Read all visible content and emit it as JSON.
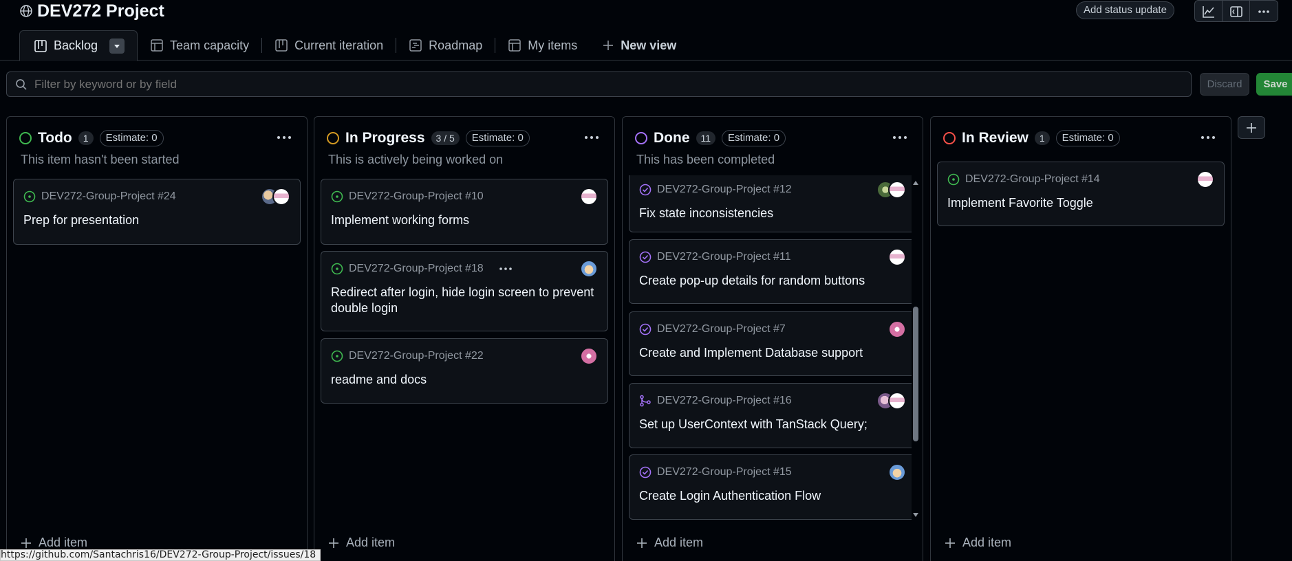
{
  "project": {
    "title": "DEV272 Project",
    "status_update": "Add status update"
  },
  "tabs": [
    {
      "label": "Backlog",
      "icon": "board-icon"
    },
    {
      "label": "Team capacity",
      "icon": "table-icon"
    },
    {
      "label": "Current iteration",
      "icon": "board-icon"
    },
    {
      "label": "Roadmap",
      "icon": "roadmap-icon"
    },
    {
      "label": "My items",
      "icon": "table-icon"
    },
    {
      "label": "New view",
      "icon": "plus-icon"
    }
  ],
  "filter": {
    "placeholder": "Filter by keyword or by field",
    "discard": "Discard",
    "save": "Save"
  },
  "colors": {
    "todo": "#3fb950",
    "in_progress": "#d29922",
    "done": "#a371f7",
    "in_review": "#f85149",
    "accent_save": "#238636"
  },
  "columns": [
    {
      "name": "Todo",
      "count": "1",
      "estimate": "Estimate: 0",
      "description": "This item hasn't been started",
      "add_item": "Add item",
      "cards": [
        {
          "ref": "DEV272-Group-Project #24",
          "title": "Prep for presentation"
        }
      ]
    },
    {
      "name": "In Progress",
      "count": "3 / 5",
      "estimate": "Estimate: 0",
      "description": "This is actively being worked on",
      "add_item": "Add item",
      "cards": [
        {
          "ref": "DEV272-Group-Project #10",
          "title": "Implement working forms"
        },
        {
          "ref": "DEV272-Group-Project #18",
          "title": "Redirect after login, hide login screen to prevent double login"
        },
        {
          "ref": "DEV272-Group-Project #22",
          "title": "readme and docs"
        }
      ]
    },
    {
      "name": "Done",
      "count": "11",
      "estimate": "Estimate: 0",
      "description": "This has been completed",
      "add_item": "Add item",
      "cards": [
        {
          "ref": "DEV272-Group-Project #12",
          "title": "Fix state inconsistencies"
        },
        {
          "ref": "DEV272-Group-Project #11",
          "title": "Create pop-up details for random buttons"
        },
        {
          "ref": "DEV272-Group-Project #7",
          "title": "Create and Implement Database support"
        },
        {
          "ref": "DEV272-Group-Project #16",
          "title": "Set up UserContext with TanStack Query;"
        },
        {
          "ref": "DEV272-Group-Project #15",
          "title": "Create Login Authentication Flow"
        }
      ]
    },
    {
      "name": "In Review",
      "count": "1",
      "estimate": "Estimate: 0",
      "description": "",
      "add_item": "Add item",
      "cards": [
        {
          "ref": "DEV272-Group-Project #14",
          "title": "Implement Favorite Toggle"
        }
      ]
    }
  ],
  "statusbar": {
    "url": "https://github.com/Santachris16/DEV272-Group-Project/issues/18"
  }
}
